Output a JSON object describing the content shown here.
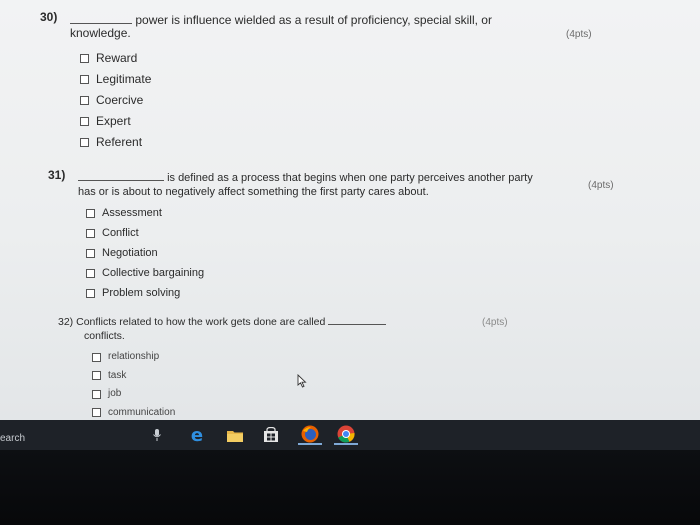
{
  "q30": {
    "number": "30)",
    "text_before_blank": "",
    "text_after_blank": "power is influence wielded as a result of proficiency, special skill, or",
    "text_line2": "knowledge.",
    "points": "(4pts)",
    "options": [
      "Reward",
      "Legitimate",
      "Coercive",
      "Expert",
      "Referent"
    ]
  },
  "q31": {
    "number": "31)",
    "text_after_blank": "is defined as a process that begins when one party perceives another party",
    "text_line2": "has or is about to negatively affect something the first party cares about.",
    "points": "(4pts)",
    "options": [
      "Assessment",
      "Conflict",
      "Negotiation",
      "Collective bargaining",
      "Problem solving"
    ]
  },
  "q32": {
    "number": "32)",
    "text_before_blank": "Conflicts related to how the work gets done are called",
    "text_line2": "conflicts.",
    "points": "(4pts)",
    "options": [
      "relationship",
      "task",
      "job",
      "communication"
    ]
  },
  "taskbar": {
    "search_text": "earch",
    "icons": [
      "microphone-icon",
      "edge-browser-icon",
      "file-explorer-icon",
      "store-icon",
      "firefox-icon",
      "chrome-icon"
    ]
  }
}
